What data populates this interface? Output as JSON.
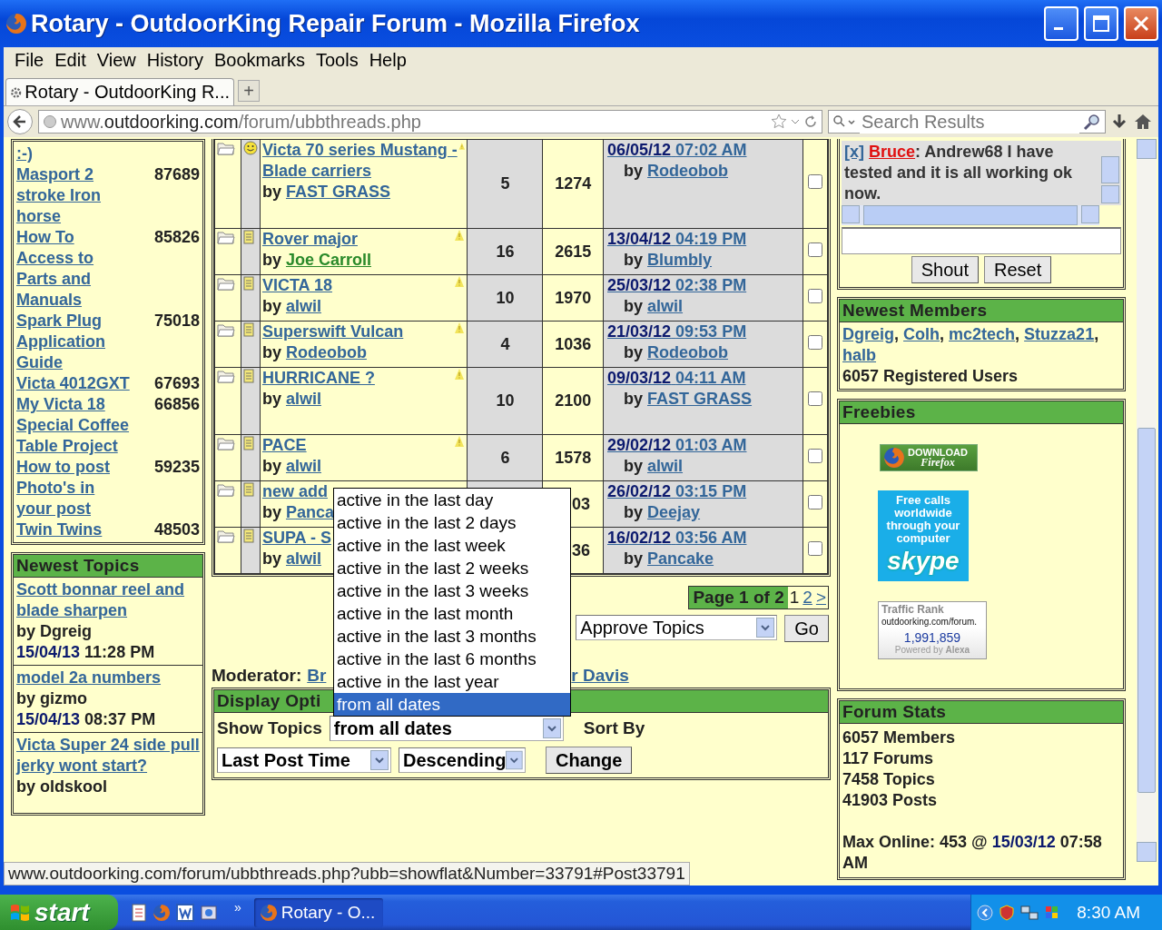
{
  "window": {
    "title": "Rotary - OutdoorKing Repair Forum - Mozilla Firefox"
  },
  "menu": [
    "File",
    "Edit",
    "View",
    "History",
    "Bookmarks",
    "Tools",
    "Help"
  ],
  "tabs": [
    {
      "label": "Rotary - OutdoorKing R...",
      "selected": true
    }
  ],
  "new_tab": "+",
  "address": {
    "prefix": "www.",
    "domain": "outdoorking.com",
    "path": "/forum/ubbthreads.php"
  },
  "search": {
    "placeholder": "Search Results"
  },
  "left_list": [
    {
      "title": ":-)"
    },
    {
      "title": "Masport 2 stroke Iron horse",
      "count": "87689"
    },
    {
      "title": "How To Access to Parts and Manuals",
      "count": "85826"
    },
    {
      "title": "Spark Plug Application Guide",
      "count": "75018"
    },
    {
      "title": "Victa 4012GXT",
      "count": "67693"
    },
    {
      "title": "My Victa 18 Special Coffee Table Project",
      "count": "66856"
    },
    {
      "title": "How to post Photo's in your post",
      "count": "59235"
    },
    {
      "title": "Twin Twins",
      "count": "48503"
    }
  ],
  "newest_topics": {
    "title": "Newest Topics",
    "items": [
      {
        "title": "Scott bonnar reel and blade sharpen",
        "author": "by Dgreig",
        "date": "15/04/13",
        "time": "11:28 PM"
      },
      {
        "title": "model 2a numbers",
        "author": "by gizmo",
        "date": "15/04/13",
        "time": "08:37 PM"
      },
      {
        "title": "Victa Super 24 side pull jerky wont start?",
        "author": "by oldskool"
      }
    ]
  },
  "topics": [
    {
      "kind": "smiley",
      "title": "Victa 70 series Mustang - Blade carriers",
      "by": "by",
      "author": "FAST GRASS",
      "author_highlighted": false,
      "alert": true,
      "replies": "5",
      "views": "1274",
      "date": "06/05/12",
      "time": "07:02 AM",
      "last_by": "by",
      "last_author": "Rodeobob",
      "checked": false
    },
    {
      "kind": "note",
      "title": "Rover major",
      "by": "by",
      "author": "Joe Carroll",
      "author_highlighted": true,
      "alert": true,
      "replies": "16",
      "views": "2615",
      "date": "13/04/12",
      "time": "04:19 PM",
      "last_by": "by",
      "last_author": "Blumbly",
      "checked": false
    },
    {
      "kind": "note",
      "title": "VICTA 18",
      "by": "by",
      "author": "alwil",
      "author_highlighted": false,
      "alert": true,
      "replies": "10",
      "views": "1970",
      "date": "25/03/12",
      "time": "02:38 PM",
      "last_by": "by",
      "last_author": "alwil",
      "checked": false
    },
    {
      "kind": "note",
      "title": "Superswift Vulcan",
      "by": "by",
      "author": "Rodeobob",
      "author_highlighted": false,
      "alert": true,
      "replies": "4",
      "views": "1036",
      "date": "21/03/12",
      "time": "09:53 PM",
      "last_by": "by",
      "last_author": "Rodeobob",
      "checked": false
    },
    {
      "kind": "note",
      "title": "HURRICANE ?",
      "by": "by",
      "author": "alwil",
      "author_highlighted": false,
      "alert": true,
      "replies": "10",
      "views": "2100",
      "date": "09/03/12",
      "time": "04:11 AM",
      "last_by": "by",
      "last_author": "FAST GRASS",
      "checked": false
    },
    {
      "kind": "note",
      "title": "PACE",
      "by": "by",
      "author": "alwil",
      "author_highlighted": false,
      "alert": true,
      "replies": "6",
      "views": "1578",
      "date": "29/02/12",
      "time": "01:03 AM",
      "last_by": "by",
      "last_author": "alwil",
      "checked": false
    },
    {
      "kind": "note",
      "title": "new add",
      "by": "by",
      "author": "Panca",
      "author_highlighted": false,
      "alert": false,
      "views": "03",
      "date": "26/02/12",
      "time": "03:15 PM",
      "last_by": "by",
      "last_author": "Deejay",
      "checked": false
    },
    {
      "kind": "note",
      "title": "SUPA - S",
      "by": "by",
      "author": "alwil",
      "author_highlighted": false,
      "alert": false,
      "views": "36",
      "date": "16/02/12",
      "time": "03:56 AM",
      "last_by": "by",
      "last_author": "Pancake",
      "checked": false
    }
  ],
  "pagination": {
    "label": "Page 1 of 2",
    "pages": [
      {
        "label": "1",
        "selected": true
      },
      {
        "label": "2",
        "selected": false
      },
      {
        "label": ">",
        "selected": false
      }
    ]
  },
  "moderation": {
    "select": "Approve Topics",
    "button": "Go"
  },
  "moderator": {
    "label": "Moderator:",
    "names": [
      "Br",
      "r Davis"
    ]
  },
  "display_options": {
    "title": "Display Opti",
    "show_label": "Show Topics",
    "show_value": "from all dates",
    "sort_label": "Sort By",
    "sort_field": "Last Post Time",
    "sort_order": "Descending",
    "button": "Change"
  },
  "dropdown": [
    {
      "label": "active in the last day",
      "selected": false
    },
    {
      "label": "active in the last 2 days",
      "selected": false
    },
    {
      "label": "active in the last week",
      "selected": false
    },
    {
      "label": "active in the last 2 weeks",
      "selected": false
    },
    {
      "label": "active in the last 3 weeks",
      "selected": false
    },
    {
      "label": "active in the last month",
      "selected": false
    },
    {
      "label": "active in the last 3 months",
      "selected": false
    },
    {
      "label": "active in the last 6 months",
      "selected": false
    },
    {
      "label": "active in the last year",
      "selected": false
    },
    {
      "label": "from all dates",
      "selected": true
    }
  ],
  "shoutbox": {
    "close": "[x]",
    "name": "Bruce",
    "message": ": Andrew68 I have tested and it is all working ok now.",
    "buttons": [
      "Shout",
      "Reset"
    ]
  },
  "newest_members": {
    "title": "Newest Members",
    "members": [
      {
        "name": "Dgreig",
        "sep": ","
      },
      {
        "name": "Colh",
        "sep": ","
      },
      {
        "name": "mc2tech",
        "sep": ","
      },
      {
        "name": "Stuzza21",
        "sep": ","
      },
      {
        "name": "halb"
      }
    ],
    "total": "6057 Registered Users"
  },
  "freebies": {
    "title": "Freebies",
    "firefox": {
      "line1": "DOWNLOAD",
      "line2": "Firefox"
    },
    "skype": {
      "text": "Free calls worldwide through your computer",
      "logo": "skype"
    },
    "alexa": {
      "title": "Traffic Rank",
      "site": "outdoorking.com/forum.",
      "rank": "1,991,859",
      "powered": "Powered by",
      "brand": "Alexa"
    }
  },
  "forum_stats": {
    "title": "Forum Stats",
    "stats": [
      "6057 Members",
      "117 Forums",
      "7458 Topics",
      "41903 Posts"
    ],
    "max_label": "Max Online: 453 @",
    "max_date": "15/03/12",
    "max_time": "07:58 AM"
  },
  "status_url": "www.outdoorking.com/forum/ubbthreads.php?ubb=showflat&Number=33791#Post33791",
  "taskbar": {
    "start": "start",
    "overflow": "»",
    "tasks": [
      {
        "label": "Rotary - O...",
        "selected": true
      }
    ],
    "clock": "8:30 AM"
  }
}
